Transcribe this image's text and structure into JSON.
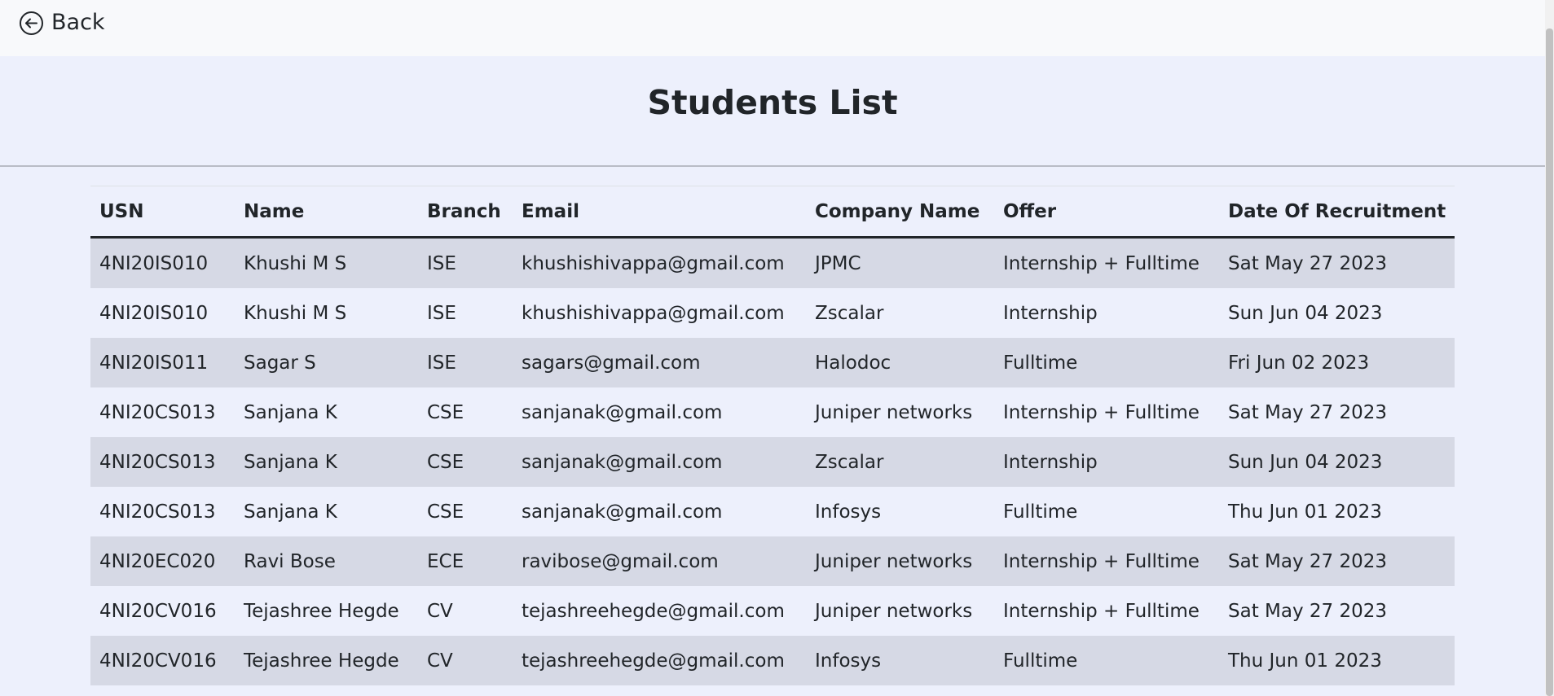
{
  "nav": {
    "back_label": "Back"
  },
  "page": {
    "title": "Students List"
  },
  "table": {
    "columns": [
      "USN",
      "Name",
      "Branch",
      "Email",
      "Company Name",
      "Offer",
      "Date Of Recruitment"
    ],
    "rows": [
      [
        "4NI20IS010",
        "Khushi M S",
        "ISE",
        "khushishivappa@gmail.com",
        "JPMC",
        "Internship + Fulltime",
        "Sat May 27 2023"
      ],
      [
        "4NI20IS010",
        "Khushi M S",
        "ISE",
        "khushishivappa@gmail.com",
        "Zscalar",
        "Internship",
        "Sun Jun 04 2023"
      ],
      [
        "4NI20IS011",
        "Sagar S",
        "ISE",
        "sagars@gmail.com",
        "Halodoc",
        "Fulltime",
        "Fri Jun 02 2023"
      ],
      [
        "4NI20CS013",
        "Sanjana K",
        "CSE",
        "sanjanak@gmail.com",
        "Juniper networks",
        "Internship + Fulltime",
        "Sat May 27 2023"
      ],
      [
        "4NI20CS013",
        "Sanjana K",
        "CSE",
        "sanjanak@gmail.com",
        "Zscalar",
        "Internship",
        "Sun Jun 04 2023"
      ],
      [
        "4NI20CS013",
        "Sanjana K",
        "CSE",
        "sanjanak@gmail.com",
        "Infosys",
        "Fulltime",
        "Thu Jun 01 2023"
      ],
      [
        "4NI20EC020",
        "Ravi Bose",
        "ECE",
        "ravibose@gmail.com",
        "Juniper networks",
        "Internship + Fulltime",
        "Sat May 27 2023"
      ],
      [
        "4NI20CV016",
        "Tejashree Hegde",
        "CV",
        "tejashreehegde@gmail.com",
        "Juniper networks",
        "Internship + Fulltime",
        "Sat May 27 2023"
      ],
      [
        "4NI20CV016",
        "Tejashree Hegde",
        "CV",
        "tejashreehegde@gmail.com",
        "Infosys",
        "Fulltime",
        "Thu Jun 01 2023"
      ]
    ]
  },
  "icons": {
    "back": "arrow-left-circle-icon"
  }
}
